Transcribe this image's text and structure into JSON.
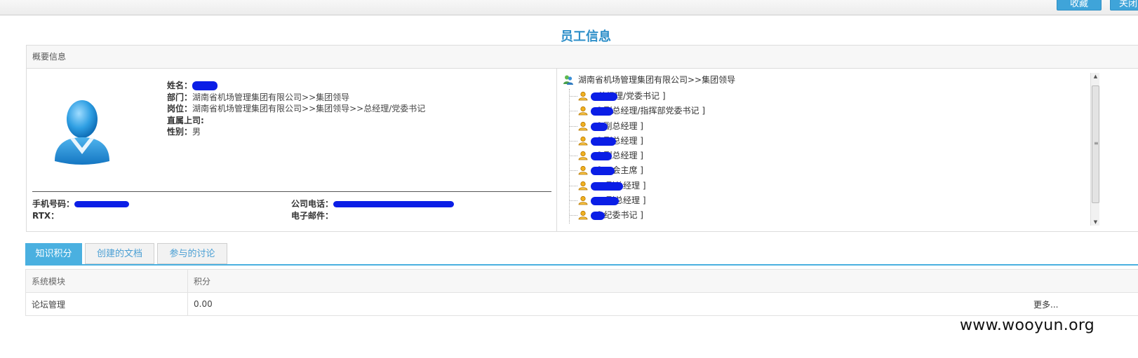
{
  "toolbar": {
    "favorite_label": "收藏",
    "close_label": "关闭"
  },
  "page_title": "员工信息",
  "summary": {
    "header": "概要信息",
    "fields": [
      {
        "label": "姓名：",
        "value": ""
      },
      {
        "label": "部门：",
        "value": "湖南省机场管理集团有限公司>>集团领导"
      },
      {
        "label": "岗位：",
        "value": "湖南省机场管理集团有限公司>>集团领导>>总经理/党委书记"
      },
      {
        "label": "直属上司:",
        "value": ""
      },
      {
        "label": "性别：",
        "value": "男"
      }
    ],
    "contact": {
      "mobile_label": "手机号码：",
      "rtx_label": "RTX：",
      "company_phone_label": "公司电话：",
      "email_label": "电子邮件："
    }
  },
  "org_tree": {
    "root_label": "湖南省机场管理集团有限公司>>集团领导",
    "items": [
      {
        "title": "总经理/党委书记 ]"
      },
      {
        "title": "[ 副总经理/指挥部党委书记 ]"
      },
      {
        "title": "[ 副总经理 ]"
      },
      {
        "title": "[ 副总经理 ]"
      },
      {
        "title": "[ 副总经理 ]"
      },
      {
        "title": "[ 工会主席 ]"
      },
      {
        "title": "副总经理 ]"
      },
      {
        "title": "副总经理 ]"
      },
      {
        "title": "[ 纪委书记 ]"
      }
    ]
  },
  "tabs": [
    {
      "label": "知识积分",
      "active": true
    },
    {
      "label": "创建的文档",
      "active": false
    },
    {
      "label": "参与的讨论",
      "active": false
    }
  ],
  "score_table": {
    "headers": [
      "系统模块",
      "积分"
    ],
    "rows": [
      {
        "module": "论坛管理",
        "score": "0.00"
      }
    ],
    "more_label": "更多..."
  },
  "watermark": "www.wooyun.org",
  "colors": {
    "accent": "#2e8fc9",
    "tab_active": "#4ab0e0",
    "redaction": "#0b1ee6"
  }
}
